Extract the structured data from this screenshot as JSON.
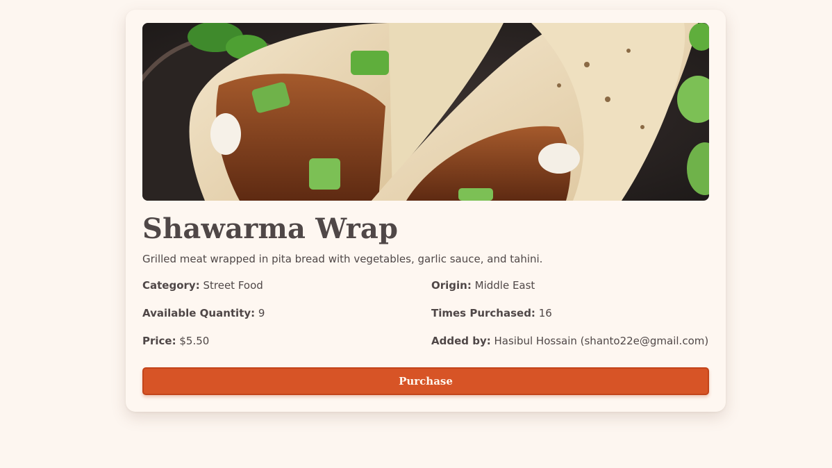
{
  "product": {
    "image_alt": "Shawarma wraps with grilled chicken and cucumber",
    "name": "Shawarma Wrap",
    "description": "Grilled meat wrapped in pita bread with vegetables, garlic sauce, and tahini."
  },
  "details": {
    "category_label": "Category:",
    "category_value": " Street Food",
    "origin_label": "Origin:",
    "origin_value": " Middle East",
    "quantity_label": "Available Quantity:",
    "quantity_value": " 9",
    "purchased_label": "Times Purchased:",
    "purchased_value": " 16",
    "price_label": "Price:",
    "price_value": " $5.50",
    "added_by_label": "Added by:",
    "added_by_value": " Hasibul Hossain (shanto22e@gmail.com)"
  },
  "actions": {
    "purchase_label": "Purchase"
  },
  "colors": {
    "accent": "#d75426",
    "page_background": "#fdf6f0",
    "text": "#4f4747"
  }
}
